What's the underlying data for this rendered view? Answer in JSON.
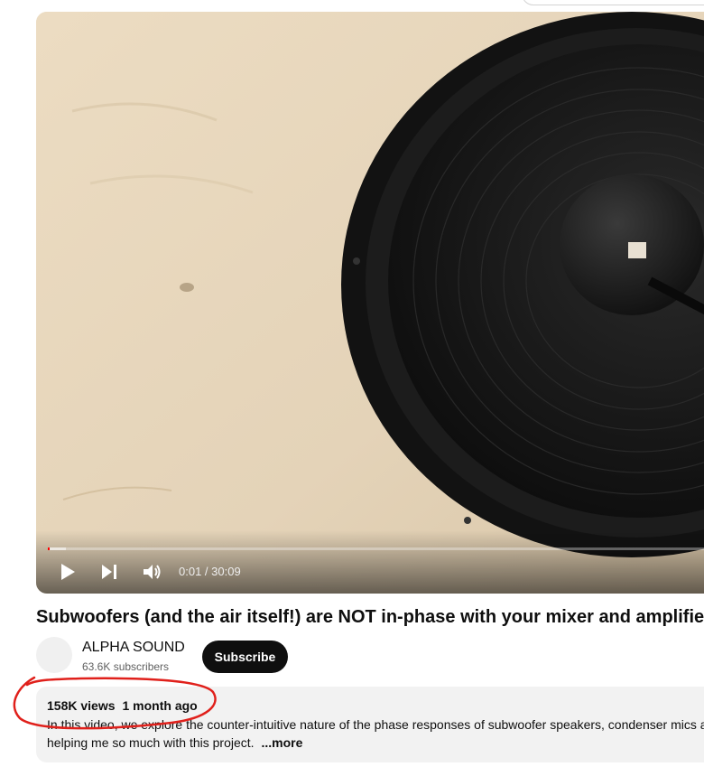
{
  "player": {
    "current_time": "0:01",
    "duration": "30:09",
    "time_separator": " / ",
    "progress_fraction": 0.0006
  },
  "video": {
    "title": "Subwoofers (and the air itself!) are NOT in-phase with your mixer and amplifier."
  },
  "channel": {
    "name": "ALPHA SOUND",
    "subscribers": "63.6K subscribers",
    "subscribe_label": "Subscribe"
  },
  "description": {
    "views": "158K views",
    "age": "1 month ago",
    "line1": "In this video, we explore the counter-intuitive nature of the phase responses of subwoofer speakers, condenser mics a",
    "line2": "helping me so much with this project.",
    "more_label": "...more"
  },
  "icons": {
    "play": "play-icon",
    "next": "next-icon",
    "volume": "volume-icon"
  },
  "colors": {
    "annotation": "#e0201b",
    "subscribe_bg": "#0f0f0f",
    "description_bg": "#f2f2f2"
  }
}
